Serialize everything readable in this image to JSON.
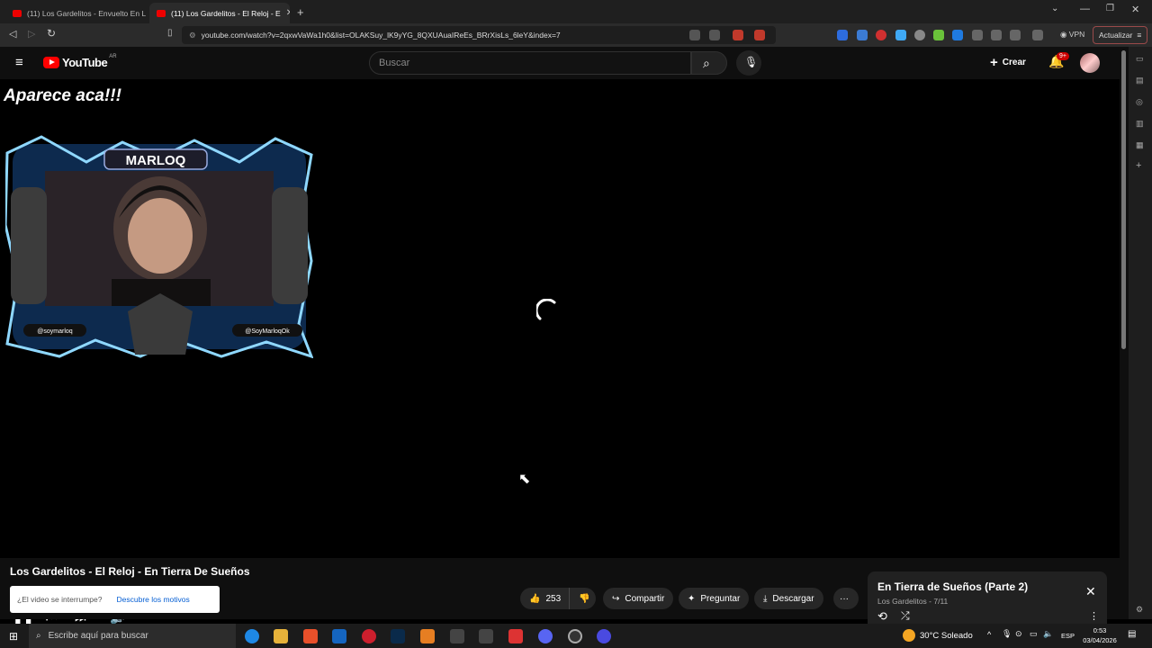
{
  "browser": {
    "tabs": [
      {
        "label": "(11) Los Gardelitos - Envuelto En Lla"
      },
      {
        "label": "(11) Los Gardelitos - El Reloj - E"
      }
    ],
    "url": "youtube.com/watch?v=2qxwVaWa1h0&list=OLAKSuy_lK9yYG_8QXUAuaIReEs_BRrXisLs_6leY&index=7",
    "vpn_label": "VPN",
    "update_label": "Actualizar"
  },
  "youtube": {
    "logo_text": "YouTube",
    "region": "AR",
    "search_placeholder": "Buscar",
    "create_label": "Crear",
    "notifications_badge": "9+"
  },
  "video": {
    "overlay_text": "Aparece aca!!!",
    "cam_name": "MARLOQ",
    "cam_left_handle": "@soymarloq",
    "cam_right_handle": "@SoyMarloqOk",
    "time": "0:00 / 2:57",
    "progress": 0.0
  },
  "info": {
    "title": "Los Gardelitos - El Reloj - En Tierra De Sueños",
    "interrupt_question": "¿El video se interrumpe?",
    "interrupt_link": "Descubre los motivos",
    "likes": "253",
    "share_label": "Compartir",
    "ask_label": "Preguntar",
    "download_label": "Descargar"
  },
  "playlist": {
    "title": "En Tierra de Sueños (Parte 2)",
    "subtitle": "Los Gardelitos - 7/11"
  },
  "taskbar": {
    "search_placeholder": "Escribe aquí para buscar",
    "weather": "30°C  Soleado",
    "lang": "ESP",
    "time": "0:53",
    "date": "03/04/2026"
  }
}
